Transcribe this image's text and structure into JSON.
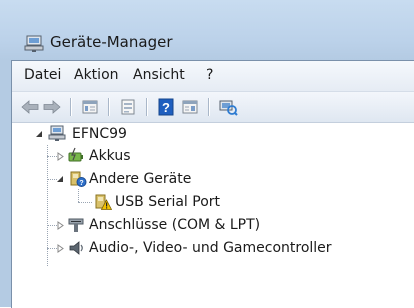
{
  "window": {
    "title": "Geräte-Manager",
    "icon": "device-manager-icon"
  },
  "menubar": {
    "items": [
      "Datei",
      "Aktion",
      "Ansicht",
      "?"
    ]
  },
  "toolbar": {
    "buttons": [
      "back-arrow-icon",
      "forward-arrow-icon",
      "console-tree-icon",
      "properties-icon",
      "help-icon",
      "view-icon",
      "scan-hardware-icon"
    ]
  },
  "tree": {
    "root": {
      "label": "EFNC99",
      "icon": "computer-icon",
      "expanded": true
    },
    "nodes": [
      {
        "label": "Akkus",
        "icon": "battery-icon",
        "expanded": false
      },
      {
        "label": "Andere Geräte",
        "icon": "unknown-device-icon",
        "expanded": true,
        "children": [
          {
            "label": "USB Serial Port",
            "icon": "warning-device-icon"
          }
        ]
      },
      {
        "label": "Anschlüsse (COM & LPT)",
        "icon": "port-icon",
        "expanded": false
      },
      {
        "label": "Audio-, Video- und Gamecontroller",
        "icon": "audio-icon",
        "expanded": false
      }
    ]
  },
  "colors": {
    "frame": "#bcd2ea",
    "help_blue": "#1f5fbf",
    "warning_yellow": "#f2c200"
  }
}
